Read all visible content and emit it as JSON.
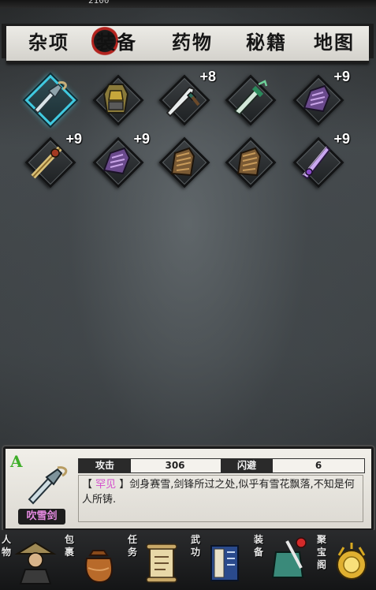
{
  "top": {
    "coin_partial": "2100"
  },
  "tabs": [
    {
      "label": "杂项",
      "active": false
    },
    {
      "label": "装备",
      "active": true
    },
    {
      "label": "药物",
      "active": false
    },
    {
      "label": "秘籍",
      "active": false
    },
    {
      "label": "地图",
      "active": false
    }
  ],
  "inventory": {
    "rows": [
      [
        {
          "item": "dagger",
          "plus": "",
          "selected": true
        },
        {
          "item": "armor",
          "plus": "",
          "selected": false
        },
        {
          "item": "sword",
          "plus": "+8",
          "selected": false
        },
        {
          "item": "jade-sword",
          "plus": "",
          "selected": false
        },
        {
          "item": "purple-gauntlet",
          "plus": "+9",
          "selected": false
        }
      ],
      [
        {
          "item": "gold-staff",
          "plus": "+9",
          "selected": false
        },
        {
          "item": "purple-gauntlet",
          "plus": "+9",
          "selected": false
        },
        {
          "item": "bronze-gauntlet",
          "plus": "",
          "selected": false
        },
        {
          "item": "bronze-gauntlet",
          "plus": "",
          "selected": false
        },
        {
          "item": "purple-blade",
          "plus": "+9",
          "selected": false
        }
      ]
    ]
  },
  "detail": {
    "grade": "A",
    "name": "吹雪剑",
    "icon": "dagger-icon",
    "stat1_label": "攻击",
    "stat1_value": "306",
    "stat2_label": "闪避",
    "stat2_value": "6",
    "rarity": "罕见",
    "description": "剑身赛雪,剑锋所过之处,似乎有雪花飘落,不知是何人所铸."
  },
  "bottom_nav": [
    {
      "label": "人物",
      "icon": "character-icon"
    },
    {
      "label": "包裹",
      "icon": "bag-icon"
    },
    {
      "label": "任务",
      "icon": "scroll-icon"
    },
    {
      "label": "武功",
      "icon": "book-icon"
    },
    {
      "label": "装备",
      "icon": "equipment-icon"
    },
    {
      "label": "聚宝阁",
      "icon": "treasure-icon"
    }
  ],
  "colors": {
    "selected_frame": "#3fc9e0",
    "rarity": "#d34bcc",
    "grade": "#3fae2a",
    "seal_red": "#b3241f"
  }
}
